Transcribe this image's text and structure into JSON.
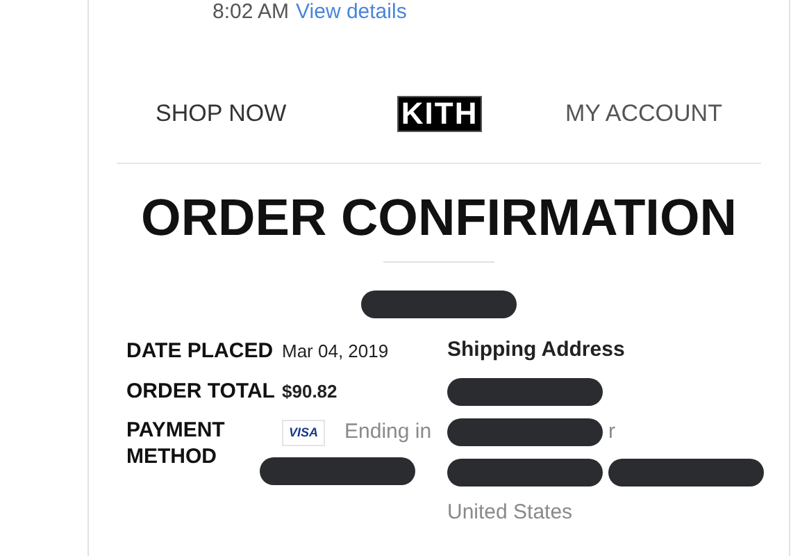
{
  "header": {
    "time": "8:02 AM",
    "link": "View details"
  },
  "nav": {
    "left": "SHOP NOW",
    "logo": "KITH",
    "right": "MY ACCOUNT"
  },
  "title": "ORDER CONFIRMATION",
  "order_number": [
    {
      "kind": "redacted"
    }
  ],
  "details": [
    {
      "label": "DATE PLACED",
      "value": [
        {
          "kind": "text",
          "text": "Mar 04, 2019",
          "bold": false
        }
      ]
    },
    {
      "label": "ORDER TOTAL",
      "value": [
        {
          "kind": "text",
          "text": "$90.82",
          "bold": true
        }
      ]
    },
    {
      "label": "PAYMENT METHOD",
      "value": [
        {
          "kind": "card",
          "text": "VISA"
        },
        {
          "kind": "muted",
          "text": "Ending in"
        },
        {
          "kind": "redacted"
        }
      ]
    }
  ],
  "shipping": {
    "heading": "Shipping Address",
    "lines": [
      [
        {
          "kind": "redacted"
        }
      ],
      [
        {
          "kind": "redacted"
        },
        {
          "kind": "muted",
          "text": "r"
        }
      ],
      [
        {
          "kind": "redacted"
        },
        {
          "kind": "redacted"
        }
      ],
      [
        {
          "kind": "muted",
          "text": "United States"
        }
      ]
    ]
  }
}
